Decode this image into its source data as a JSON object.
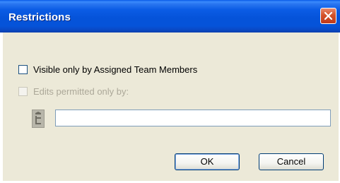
{
  "dialog": {
    "title": "Restrictions"
  },
  "options": {
    "visible_only_label": "Visible only by Assigned Team Members",
    "visible_only_checked": false,
    "edits_permitted_label": "Edits permitted only by:",
    "edits_permitted_checked": false,
    "edits_permitted_enabled": false
  },
  "members_field": {
    "value": ""
  },
  "buttons": {
    "ok_label": "OK",
    "cancel_label": "Cancel"
  },
  "icons": {
    "close": "close-icon",
    "member_picker": "member-picker-icon"
  },
  "colors": {
    "titlebar": "#0553d9",
    "close_button": "#d4532a",
    "dialog_face": "#ece9d8",
    "disabled_text": "#aca899"
  }
}
